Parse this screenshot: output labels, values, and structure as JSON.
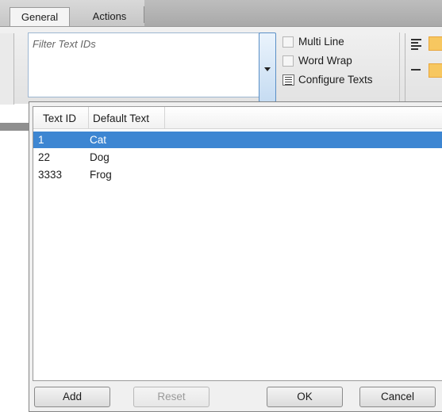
{
  "tabs": [
    {
      "label": "General",
      "active": true
    },
    {
      "label": "Actions",
      "active": false
    }
  ],
  "ribbon": {
    "filter_placeholder": "Filter Text IDs",
    "options": {
      "multi_line": "Multi Line",
      "word_wrap": "Word Wrap",
      "configure_texts": "Configure Texts"
    }
  },
  "grid": {
    "columns": [
      "Text ID",
      "Default Text"
    ],
    "rows": [
      {
        "id": "1",
        "text": "Cat",
        "selected": true
      },
      {
        "id": "22",
        "text": "Dog",
        "selected": false
      },
      {
        "id": "3333",
        "text": "Frog",
        "selected": false
      }
    ]
  },
  "buttons": {
    "add": "Add",
    "reset": "Reset",
    "ok": "OK",
    "cancel": "Cancel"
  },
  "colors": {
    "selection": "#3d86d2",
    "highlight": "#f7c760"
  },
  "icons": [
    "dropdown-arrow-icon",
    "configure-texts-icon",
    "align-left-icon",
    "align-center-icon"
  ]
}
